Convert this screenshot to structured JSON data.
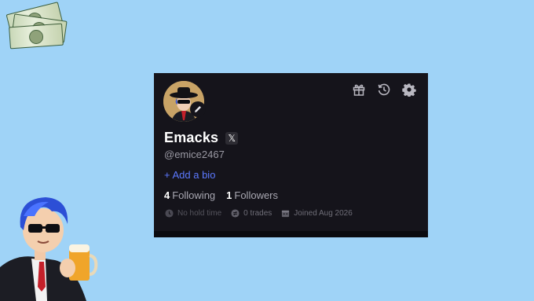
{
  "profile": {
    "display_name": "Emacks",
    "x_badge": "𝕏",
    "handle": "@emice2467",
    "add_bio_label": "+ Add a bio",
    "following_count": "4",
    "following_label": "Following",
    "followers_count": "1",
    "followers_label": "Followers",
    "hold_time": "No hold time",
    "trades": "0 trades",
    "joined": "Joined Aug 2026"
  },
  "icons": {
    "gift": "gift-icon",
    "history": "history-icon",
    "settings": "gear-icon",
    "edit": "pencil-icon",
    "clock": "clock-icon",
    "trades": "swap-icon",
    "calendar": "calendar-icon"
  },
  "colors": {
    "background": "#9fd3f7",
    "card": "#15141b",
    "accent": "#5c79ff",
    "muted": "#9a99a3"
  }
}
